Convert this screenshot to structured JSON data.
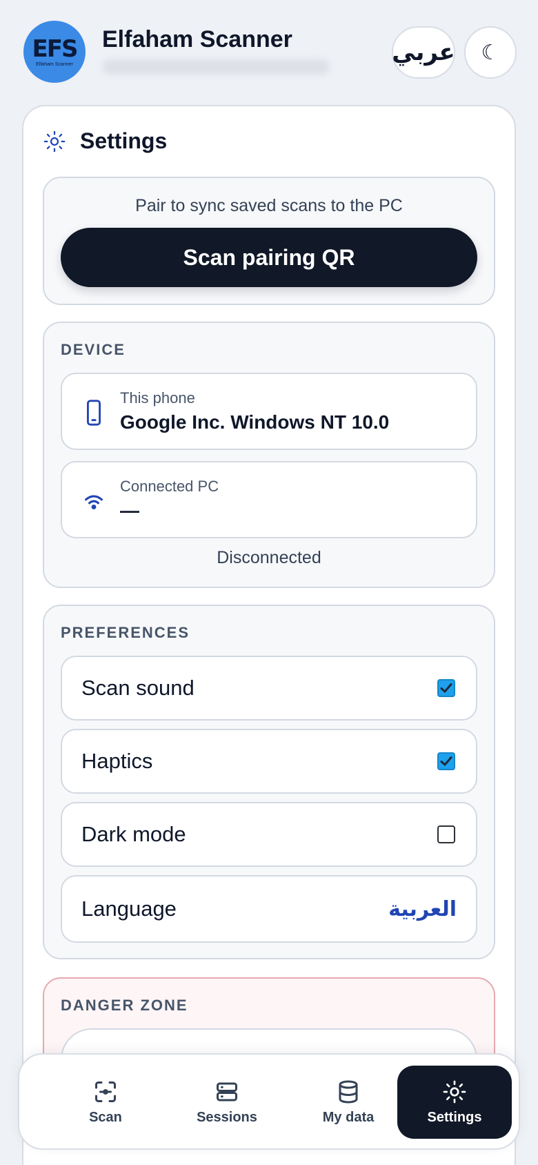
{
  "header": {
    "logo_mark": "EFS",
    "logo_sub": "Elfaham Scanner",
    "title": "Elfaham Scanner",
    "lang_button": "عربي",
    "theme_button": "☾"
  },
  "settings": {
    "title": "Settings"
  },
  "pairing": {
    "hint": "Pair to sync saved scans to the PC",
    "button": "Scan pairing QR"
  },
  "device": {
    "section": "DEVICE",
    "phone_label": "This phone",
    "phone_value": "Google Inc. Windows NT 10.0",
    "pc_label": "Connected PC",
    "pc_value": "—",
    "status": "Disconnected"
  },
  "preferences": {
    "section": "PREFERENCES",
    "items": [
      {
        "label": "Scan sound",
        "checked": true
      },
      {
        "label": "Haptics",
        "checked": true
      },
      {
        "label": "Dark mode",
        "checked": false
      }
    ],
    "language_label": "Language",
    "language_value": "العربية"
  },
  "danger": {
    "section": "DANGER ZONE"
  },
  "nav": {
    "items": [
      {
        "label": "Scan",
        "icon": "scan-icon"
      },
      {
        "label": "Sessions",
        "icon": "sessions-icon"
      },
      {
        "label": "My data",
        "icon": "database-icon"
      },
      {
        "label": "Settings",
        "icon": "settings-icon",
        "active": true
      }
    ]
  },
  "colors": {
    "accent": "#111827",
    "link": "#2145b5",
    "checkbox": "#1ea0ec",
    "danger_border": "#e7a9b0"
  }
}
